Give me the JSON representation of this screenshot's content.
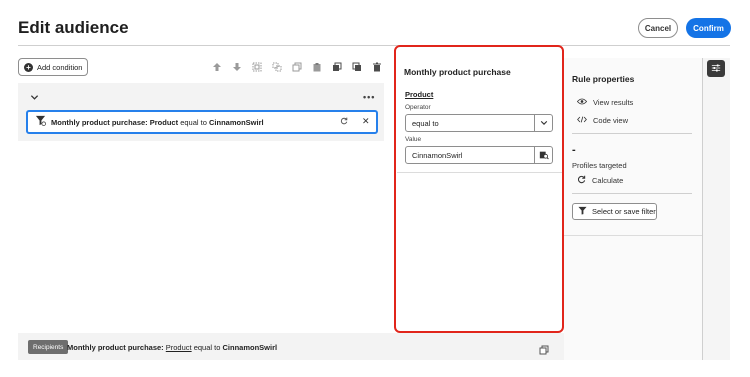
{
  "header": {
    "title": "Edit audience",
    "cancel_label": "Cancel",
    "confirm_label": "Confirm"
  },
  "toolbar": {
    "add_condition_label": "Add condition",
    "icons": [
      "move-up-icon",
      "move-down-icon",
      "group-icon",
      "ungroup-icon",
      "copy-icon",
      "paste-icon",
      "duplicate-icon",
      "duplicate-alt-icon",
      "delete-icon"
    ]
  },
  "condition": {
    "prefix": "Monthly product purchase:",
    "attribute": "Product",
    "operator": "equal to",
    "value": "CinnamonSwirl"
  },
  "editor": {
    "title": "Monthly product purchase",
    "field_label": "Product",
    "operator_label": "Operator",
    "operator_value": "equal to",
    "value_label": "Value",
    "value_value": "CinnamonSwirl"
  },
  "rule_properties": {
    "title": "Rule properties",
    "view_results": "View results",
    "code_view": "Code view",
    "count_placeholder": "-",
    "profiles_targeted": "Profiles targeted",
    "calculate": "Calculate",
    "select_or_save_filter": "Select or save filter"
  },
  "bottom": {
    "recipients_label": "Recipients",
    "prefix": "Monthly product purchase:",
    "attribute": "Product",
    "operator": "equal to",
    "value": "CinnamonSwirl"
  },
  "colors": {
    "accent": "#1473e6",
    "selection_border": "#2680eb",
    "highlight": "#e1251b"
  }
}
